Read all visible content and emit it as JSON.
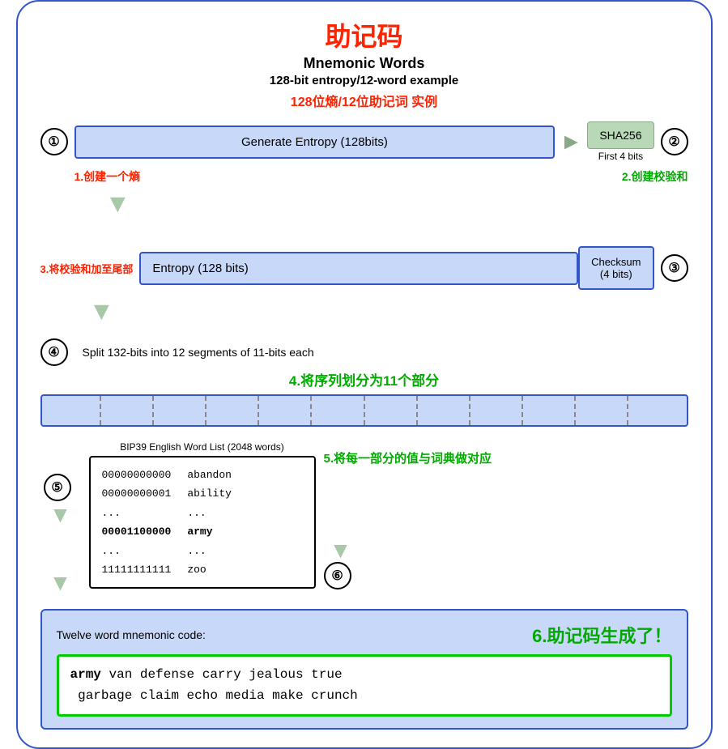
{
  "title": {
    "cn": "助记码",
    "en": "Mnemonic Words",
    "subtitle_en": "128-bit entropy/12-word example",
    "subtitle_cn": "128位熵/12位助记词 实例"
  },
  "step1": {
    "circle": "①",
    "entropy_label": "Generate Entropy (128bits)",
    "sha_label": "SHA256",
    "first4": "First 4 bits",
    "circle2": "②",
    "label_bottom": "1.创建一个熵",
    "label_top": "2.创建校验和"
  },
  "step3": {
    "label": "3.将校验和加至尾部",
    "entropy_label": "Entropy (128 bits)",
    "checksum_label": "Checksum\n(4 bits)",
    "circle": "③"
  },
  "step4": {
    "circle": "④",
    "text": "Split 132-bits into 12 segments of 11-bits each",
    "cn_label": "4.将序列划分为11个部分",
    "segments": 12
  },
  "step5": {
    "circle": "⑤",
    "circle6": "⑥",
    "bip39_label": "BIP39 English Word List (2048 words)",
    "col_binary": [
      "00000000000",
      "00000000001",
      "...",
      "00001100000",
      "...",
      "11111111111"
    ],
    "col_words": [
      "abandon",
      "ability",
      "...",
      "army",
      "...",
      "zoo"
    ],
    "label_cn": "5.将每一部分的值与词典做对应"
  },
  "step6": {
    "label": "Twelve word mnemonic code:",
    "label_cn": "6.助记码生成了！",
    "mnemonic_bold": "army",
    "mnemonic_rest": " van defense carry jealous true\n garbage claim echo media make crunch"
  }
}
